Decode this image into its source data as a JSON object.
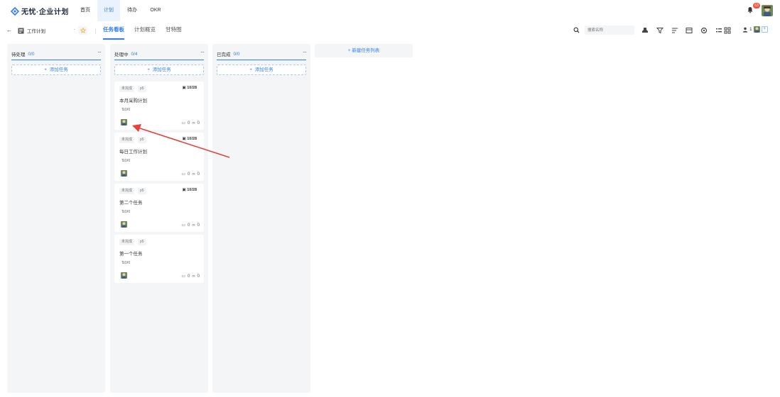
{
  "header": {
    "logo_text": "无忧·企业计划",
    "nav": [
      "首页",
      "计划",
      "待办",
      "OKR"
    ],
    "active_nav": 1,
    "notification_count": "63"
  },
  "toolbar": {
    "back_icon": "back-arrow-icon",
    "project_name": "工作计划",
    "tabs": [
      "任务看板",
      "计划概览",
      "甘特图"
    ],
    "active_tab": 0,
    "search_placeholder": "搜索名称",
    "member_count": "1",
    "add_member_label": "+"
  },
  "board": {
    "columns": [
      {
        "title": "待处理",
        "count": "0/0",
        "add_label": "添加任务",
        "cards": []
      },
      {
        "title": "处理中",
        "count": "0/4",
        "add_label": "添加任务",
        "cards": [
          {
            "status": "未完成",
            "priority": "p5",
            "due": "10/28",
            "title": "本月采购计划",
            "progress": "0/0",
            "comments": "0",
            "links": "0"
          },
          {
            "status": "未完成",
            "priority": "p5",
            "due": "10/28",
            "title": "每日工作计划",
            "progress": "0/0",
            "comments": "0",
            "links": "0"
          },
          {
            "status": "未完成",
            "priority": "p5",
            "due": "10/28",
            "title": "第二个任务",
            "progress": "0/0",
            "comments": "0",
            "links": "0"
          },
          {
            "status": "未完成",
            "priority": "p5",
            "due": "10/28",
            "title": "第一个任务",
            "progress": "0/0",
            "comments": "0",
            "links": "0"
          }
        ]
      },
      {
        "title": "已完成",
        "count": "0/0",
        "add_label": "添加任务",
        "cards": []
      }
    ],
    "new_list_label": "新建任务列表"
  },
  "colors": {
    "accent": "#2f80ed",
    "annotation_arrow": "#e8403a",
    "badge": "#f0533f",
    "column_bg": "#f4f5f7"
  }
}
